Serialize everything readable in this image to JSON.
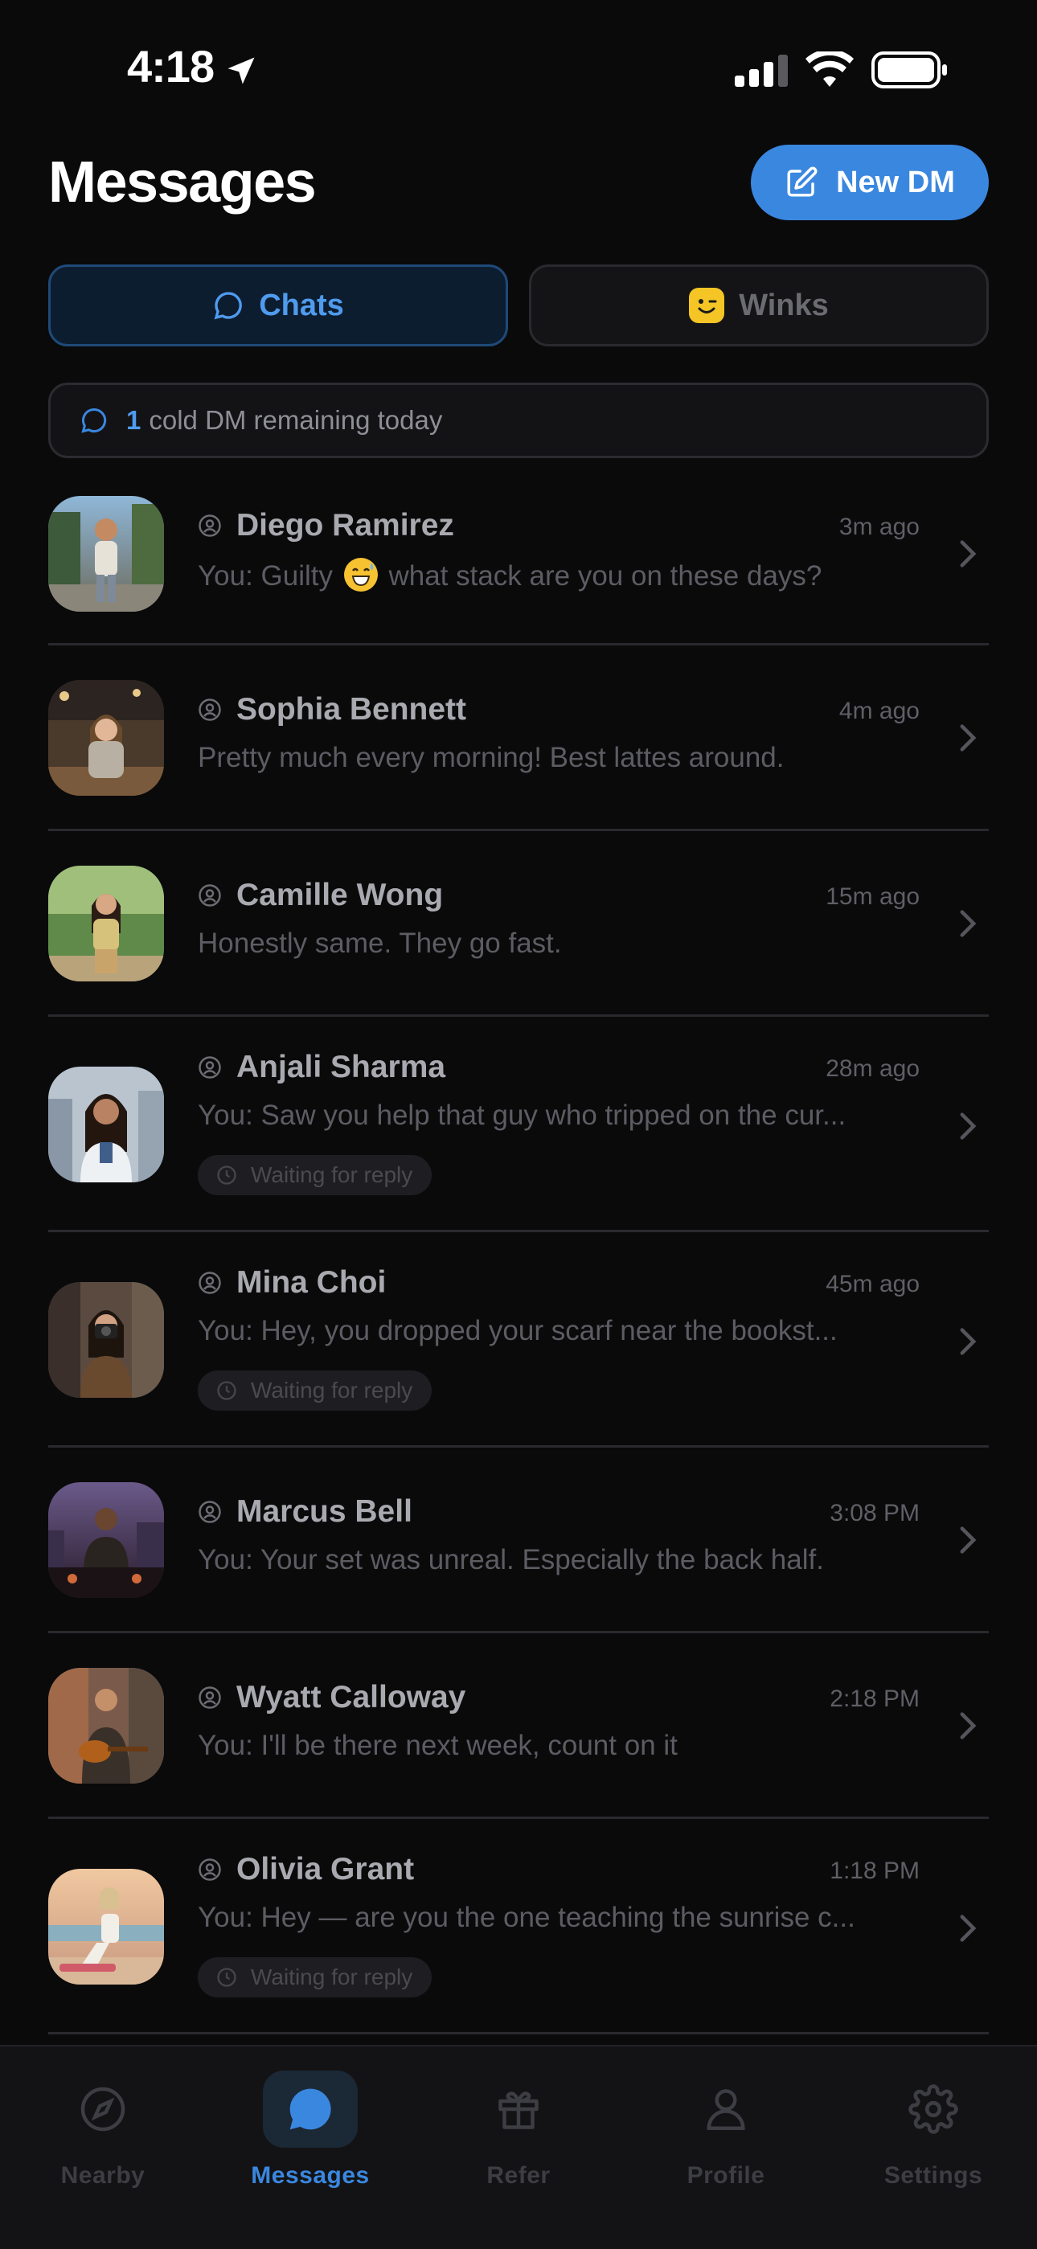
{
  "status_bar": {
    "time": "4:18"
  },
  "header": {
    "title": "Messages",
    "new_dm_label": "New DM"
  },
  "tabs": [
    {
      "label": "Chats",
      "active": true
    },
    {
      "label": "Winks",
      "active": false
    }
  ],
  "banner": {
    "count": "1",
    "text": "cold DM remaining today"
  },
  "chats": [
    {
      "name": "Diego Ramirez",
      "time": "3m ago",
      "preview_before": "You: Guilty",
      "preview_after": "what stack are you on these days?",
      "waiting": false
    },
    {
      "name": "Sophia Bennett",
      "time": "4m ago",
      "preview": "Pretty much every morning! Best lattes around.",
      "waiting": false
    },
    {
      "name": "Camille Wong",
      "time": "15m ago",
      "preview": "Honestly same. They go fast.",
      "waiting": false
    },
    {
      "name": "Anjali Sharma",
      "time": "28m ago",
      "preview": "You: Saw you help that guy who tripped on the cur...",
      "waiting": true,
      "badge": "Waiting for reply"
    },
    {
      "name": "Mina Choi",
      "time": "45m ago",
      "preview": "You: Hey, you dropped your scarf near the bookst...",
      "waiting": true,
      "badge": "Waiting for reply"
    },
    {
      "name": "Marcus Bell",
      "time": "3:08 PM",
      "preview": "You: Your set was unreal. Especially the back half.",
      "waiting": false
    },
    {
      "name": "Wyatt Calloway",
      "time": "2:18 PM",
      "preview": "You: I'll be there next week, count on it",
      "waiting": false
    },
    {
      "name": "Olivia Grant",
      "time": "1:18 PM",
      "preview": "You: Hey — are you the one teaching the sunrise c...",
      "waiting": true,
      "badge": "Waiting for reply"
    }
  ],
  "nav": [
    {
      "label": "Nearby",
      "icon": "compass-icon",
      "active": false
    },
    {
      "label": "Messages",
      "icon": "chat-bubble-icon",
      "active": true
    },
    {
      "label": "Refer",
      "icon": "gift-icon",
      "active": false
    },
    {
      "label": "Profile",
      "icon": "person-icon",
      "active": false
    },
    {
      "label": "Settings",
      "icon": "gear-icon",
      "active": false
    }
  ],
  "colors": {
    "accent": "#3a87e0",
    "background": "#0a0a0b"
  }
}
